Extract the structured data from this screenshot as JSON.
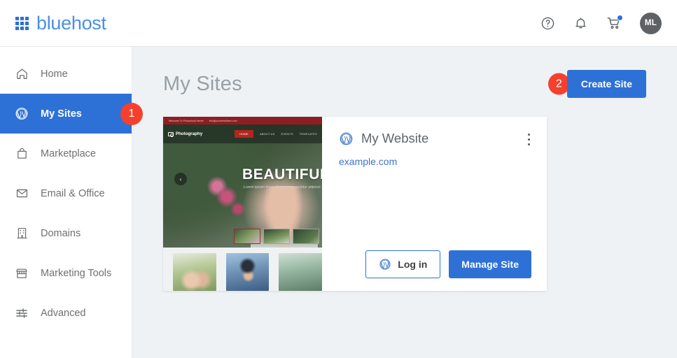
{
  "header": {
    "brand": "bluehost",
    "logo_icon": "grid-logo-icon",
    "help_icon": "help-circle-icon",
    "notifications_icon": "bell-icon",
    "cart_icon": "shopping-cart-icon",
    "avatar_initials": "ML",
    "accent_color": "#2e71d6",
    "badge_color": "#f6402e"
  },
  "sidebar": {
    "items": [
      {
        "label": "Home",
        "icon": "home-icon",
        "active": false
      },
      {
        "label": "My Sites",
        "icon": "wordpress-icon",
        "active": true,
        "badge": "1"
      },
      {
        "label": "Marketplace",
        "icon": "shopping-bag-icon",
        "active": false
      },
      {
        "label": "Email & Office",
        "icon": "envelope-icon",
        "active": false
      },
      {
        "label": "Domains",
        "icon": "building-icon",
        "active": false
      },
      {
        "label": "Marketing Tools",
        "icon": "storefront-icon",
        "active": false
      },
      {
        "label": "Advanced",
        "icon": "sliders-icon",
        "active": false
      }
    ]
  },
  "main": {
    "page_title": "My Sites",
    "create_site_label": "Create Site",
    "create_site_badge": "2"
  },
  "site_card": {
    "title": "My Website",
    "title_icon": "wordpress-icon",
    "url": "example.com",
    "menu_icon": "kebab-menu-icon",
    "login_label": "Log in",
    "login_icon": "wordpress-icon",
    "manage_label": "Manage Site",
    "thumbnail": {
      "announcement": "Welcome To Photoshoot theme",
      "email": "info@youremailhere.com",
      "logo": "Photography",
      "nav": [
        "HOME",
        "ABOUT AS",
        "EVENTS",
        "TEMPLATES"
      ],
      "hero_heading": "BEAUTIFUL",
      "hero_sub": "Lorem ipsum dolor sit amet consectetur adipisci",
      "prev_arrow": "‹"
    }
  }
}
